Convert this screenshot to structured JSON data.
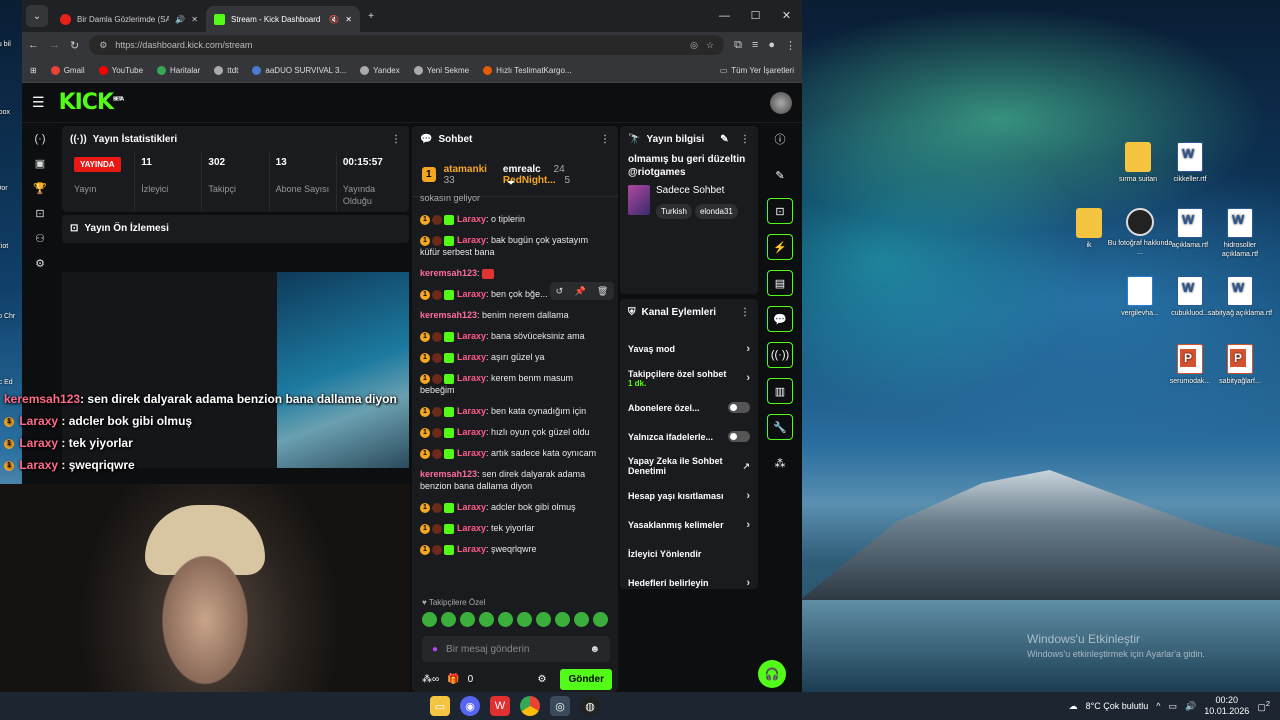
{
  "browser": {
    "tabs": [
      {
        "title": "Bir Damla Gözlerimde (SAY..."
      },
      {
        "title": "Stream - Kick Dashboard"
      }
    ],
    "url": "https://dashboard.kick.com/stream",
    "bookmarks": [
      "Gmail",
      "YouTube",
      "Haritalar",
      "ttdt",
      "aaDUO SURVIVAL 3...",
      "Yandex",
      "Yeni Sekme",
      "Hızlı TeslimatKargo..."
    ],
    "all_bookmarks": "Tüm Yer İşaretleri"
  },
  "kick": {
    "logo": "KICK",
    "logo_beta": "BETA",
    "stats": {
      "title": "Yayın İstatistikleri",
      "items": [
        {
          "value": "YAYINDA",
          "label": "Yayın"
        },
        {
          "value": "11",
          "label": "İzleyici"
        },
        {
          "value": "302",
          "label": "Takipçi"
        },
        {
          "value": "13",
          "label": "Abone Sayısı"
        },
        {
          "value": "00:15:57",
          "label": "Yayında Olduğu"
        }
      ]
    },
    "preview": {
      "title": "Yayın Ön İzlemesi"
    },
    "overlay_chat": [
      {
        "name": "keremsah123",
        "text": ": sen direk dalyarak adama benzion bana dallama diyon"
      },
      {
        "name": "Laraxy",
        "text": " : adcler bok gibi olmuş"
      },
      {
        "name": "Laraxy",
        "text": " : tek yiyorlar"
      },
      {
        "name": "Laraxy",
        "text": " : şweqriqwre"
      }
    ],
    "chat": {
      "title": "Sohbet",
      "pinned": [
        {
          "name": "atamanki",
          "count": "33"
        },
        {
          "name": "emrealc",
          "count": "24"
        },
        {
          "name": "RedNight...",
          "count": "5"
        }
      ],
      "top_fragment": "sokasın geliyor",
      "messages": [
        {
          "name": "Laraxy",
          "text": ": o tiplerin"
        },
        {
          "name": "Laraxy",
          "text": ": bak bugün çok yastayım küfür serbest bana"
        },
        {
          "name": "keremsah123",
          "text": ":"
        },
        {
          "name": "Laraxy",
          "text": ": ben çok bğe..."
        },
        {
          "name": "keremsah123",
          "text": ": benim nerem dallama"
        },
        {
          "name": "Laraxy",
          "text": ": bana sövüceksiniz ama"
        },
        {
          "name": "Laraxy",
          "text": ": aşırı güzel ya"
        },
        {
          "name": "Laraxy",
          "text": ": kerem benm masum bebeğim"
        },
        {
          "name": "Laraxy",
          "text": ": ben kata oynadığım için"
        },
        {
          "name": "Laraxy",
          "text": ": hızlı oyun çok güzel oldu"
        },
        {
          "name": "Laraxy",
          "text": ": artık sadece kata oynıcam"
        },
        {
          "name": "keremsah123",
          "text": ": sen direk dalyarak adama benzion bana dallama diyon"
        },
        {
          "name": "Laraxy",
          "text": ": adcler bok gibi olmuş"
        },
        {
          "name": "Laraxy",
          "text": ": tek yiyorlar"
        },
        {
          "name": "Laraxy",
          "text": ": şweqrlqwre"
        }
      ],
      "followers_only": "Takipçilere Özel",
      "input_placeholder": "Bir mesaj gönderin",
      "footer_count": "0",
      "send": "Gönder"
    },
    "info": {
      "title": "Yayın bilgisi",
      "stream_title": "olmamış bu geri düzeltin @riotgames",
      "category": "Sadece Sohbet",
      "tags": [
        "Turkish",
        "elonda31"
      ]
    },
    "actions": {
      "title": "Kanal Eylemleri",
      "items": [
        {
          "label": "Yavaş mod",
          "kind": "chevron"
        },
        {
          "label": "Takipçilere özel sohbet",
          "sub": "1 dk.",
          "kind": "chevron"
        },
        {
          "label": "Abonelere özel...",
          "kind": "toggle"
        },
        {
          "label": "Yalnızca ifadelerle...",
          "kind": "toggle"
        },
        {
          "label": "Yapay Zeka ile Sohbet Denetimi",
          "kind": "external"
        },
        {
          "label": "Hesap yaşı kısıtlaması",
          "kind": "chevron"
        },
        {
          "label": "Yasaklanmış kelimeler",
          "kind": "chevron"
        },
        {
          "label": "İzleyici Yönlendir",
          "kind": "none"
        },
        {
          "label": "Hedefleri belirleyin",
          "kind": "chevron"
        }
      ]
    }
  },
  "desktop": {
    "icons": [
      "sırma suitan",
      "cikkeller.rtf",
      "ik",
      "Bu fotoğraf hakkında ...",
      "açıklama.rtf",
      "hidrosoller açıklama.rtf",
      "vergilevha...",
      "cubukluod...",
      "sabityağ açıklama.rtf",
      "serumodak...",
      "sabityağlarf..."
    ],
    "watermark_title": "Windows'u Etkinleştir",
    "watermark_sub": "Windows'u etkinleştirmek için Ayarlar'a gidin.",
    "left_icons": [
      "Bu bil",
      "Xbox",
      "Dor",
      "Riot",
      "Goo Chr",
      "Mic Ed"
    ]
  },
  "taskbar": {
    "weather": "8°C  Çok bulutlu",
    "time": "00:20",
    "date": "10.01.2026",
    "notif": "2"
  }
}
